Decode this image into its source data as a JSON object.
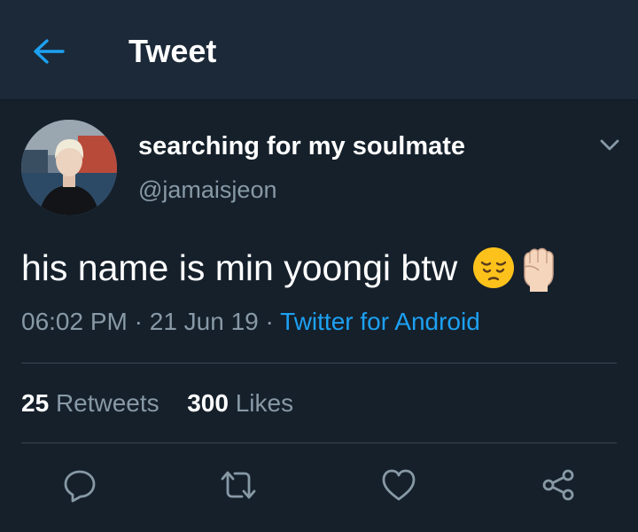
{
  "header": {
    "title": "Tweet",
    "back_icon": "arrow-left-icon"
  },
  "tweet": {
    "display_name": "searching for my soulmate",
    "handle": "@jamaisjeon",
    "text": "his name is min yoongi btw",
    "emojis": [
      "pensive-face",
      "raised-fist"
    ],
    "time": "06:02 PM",
    "date": "21 Jun 19",
    "separator": "·",
    "source": "Twitter for Android",
    "retweets_count": "25",
    "retweets_label": "Retweets",
    "likes_count": "300",
    "likes_label": "Likes"
  },
  "actions": [
    "reply-icon",
    "retweet-icon",
    "like-icon",
    "share-icon"
  ],
  "colors": {
    "background": "#15202b",
    "header_bg": "#1c2938",
    "accent": "#1da1f2",
    "secondary_text": "#8899a6",
    "divider": "#38444d"
  }
}
